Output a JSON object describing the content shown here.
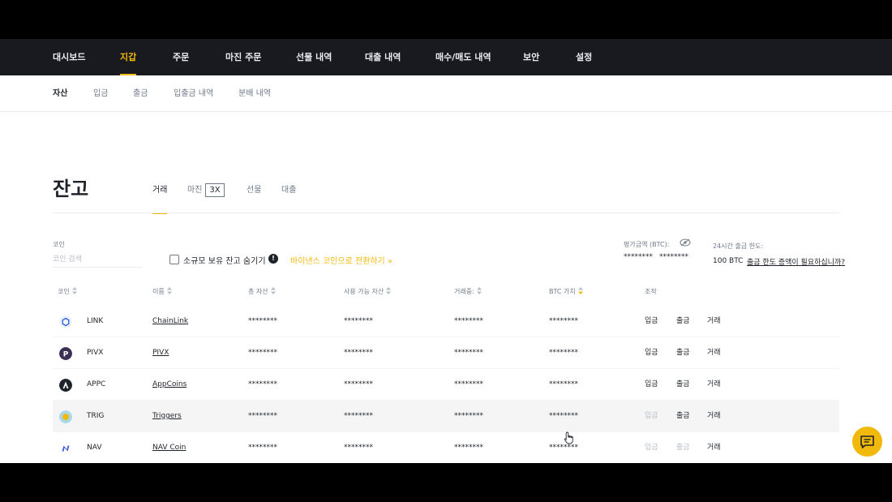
{
  "topnav": {
    "items": [
      {
        "label": "대시보드"
      },
      {
        "label": "지갑"
      },
      {
        "label": "주문"
      },
      {
        "label": "마진 주문"
      },
      {
        "label": "선물 내역"
      },
      {
        "label": "대출 내역"
      },
      {
        "label": "매수/매도 내역"
      },
      {
        "label": "보안"
      },
      {
        "label": "설정"
      }
    ],
    "active": "지갑"
  },
  "subnav": {
    "items": [
      {
        "label": "자산"
      },
      {
        "label": "입금"
      },
      {
        "label": "출금"
      },
      {
        "label": "입출금 내역"
      },
      {
        "label": "분배 내역"
      }
    ],
    "active": "자산"
  },
  "page": {
    "title": "잔고",
    "tabs": [
      {
        "label": "거래"
      },
      {
        "label": "마진",
        "badge": "3X"
      },
      {
        "label": "선물"
      },
      {
        "label": "대출"
      }
    ],
    "active_tab": "거래"
  },
  "filters": {
    "coin_label": "코인",
    "search_placeholder": "코인 검색",
    "hide_small_label": "소규모 보유 잔고 숨기기",
    "convert_link": "바이낸스 코인으로 전환하기 »"
  },
  "estimate": {
    "label": "평가금액 (BTC):",
    "btc_value": "********",
    "usd_value": "********"
  },
  "withdraw_limit": {
    "label": "24시간 출금 한도:",
    "value": "100 BTC",
    "increase_link": "출금 한도 증액이 필요하십니까?"
  },
  "table": {
    "columns": [
      "코인",
      "이름",
      "총 자산",
      "사용 가능 자산",
      "거래중:",
      "BTC 가치",
      "조작"
    ],
    "actions": {
      "deposit": "입금",
      "withdraw": "출금",
      "trade": "거래"
    },
    "rows": [
      {
        "symbol": "LINK",
        "name": "ChainLink",
        "total": "********",
        "available": "********",
        "in_order": "********",
        "btc_value": "********",
        "deposit_enabled": true,
        "withdraw_enabled": true
      },
      {
        "symbol": "PIVX",
        "name": "PIVX",
        "total": "********",
        "available": "********",
        "in_order": "********",
        "btc_value": "********",
        "deposit_enabled": true,
        "withdraw_enabled": true
      },
      {
        "symbol": "APPC",
        "name": "AppCoins",
        "total": "********",
        "available": "********",
        "in_order": "********",
        "btc_value": "********",
        "deposit_enabled": true,
        "withdraw_enabled": true
      },
      {
        "symbol": "TRIG",
        "name": "Triggers",
        "total": "********",
        "available": "********",
        "in_order": "********",
        "btc_value": "********",
        "deposit_enabled": false,
        "withdraw_enabled": true
      },
      {
        "symbol": "NAV",
        "name": "NAV Coin",
        "total": "********",
        "available": "********",
        "in_order": "********",
        "btc_value": "********",
        "deposit_enabled": false,
        "withdraw_enabled": false
      }
    ]
  },
  "colors": {
    "accent": "#f0b90b",
    "nav_bg": "#181a20",
    "text": "#1e2329",
    "muted": "#707a8a",
    "disabled": "#b7bdc6"
  },
  "icons": {
    "chat": "chat-icon",
    "eye": "eye-off-icon",
    "sort": "sort-icon",
    "info": "info-icon"
  }
}
